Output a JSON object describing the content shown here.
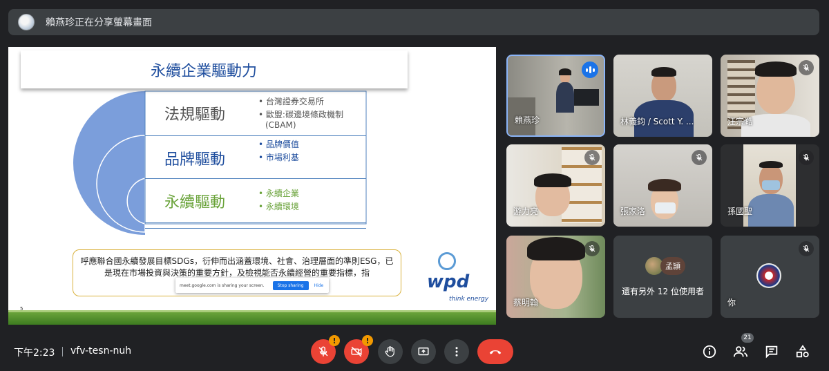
{
  "presenter_bar": {
    "text": "賴燕珍正在分享螢幕畫面"
  },
  "slide": {
    "title": "永續企業驅動力",
    "page_number": "5",
    "drivers": [
      {
        "title": "法規驅動",
        "bullets": [
          "台灣證券交易所",
          "歐盟:碳邊境條政機制",
          "(CBAM)"
        ],
        "color": "#555555"
      },
      {
        "title": "品牌驅動",
        "bullets": [
          "品牌價值",
          "市場利基"
        ],
        "color": "#1f4e9e"
      },
      {
        "title": "永續驅動",
        "bullets": [
          "永續企業",
          "永續環境"
        ],
        "color": "#6aa33a"
      }
    ],
    "ribbon_text": "呼應聯合國永續發展目標SDGs，衍伸而出涵蓋環境、社會、治理層面的準則ESG，已是現在市場投資與決策的重要方針，及檢視能否永續經營的重要指標，指",
    "share_notice": {
      "text": "meet.google.com is sharing your screen.",
      "stop": "Stop sharing",
      "hide": "Hide"
    },
    "logo": {
      "name": "wpd",
      "tagline": "think energy"
    }
  },
  "participants": [
    {
      "name": "賴燕珍",
      "status": "speaking"
    },
    {
      "name": "林義鈞 / Scott Y. ...",
      "status": "unmuted"
    },
    {
      "name": "汪宗澔",
      "status": "muted"
    },
    {
      "name": "游力亮",
      "status": "muted"
    },
    {
      "name": "張家洛",
      "status": "muted"
    },
    {
      "name": "孫國聖",
      "status": "muted"
    },
    {
      "name": "蔡明翰",
      "status": "muted"
    },
    {
      "name": "你",
      "status": "muted"
    }
  ],
  "others_tile": {
    "avatar_name": "孟頴",
    "text": "還有另外 12 位使用者"
  },
  "toolbar": {
    "time": "下午2:23",
    "meeting_code": "vfv-tesn-nuh",
    "participant_count": "21",
    "warning_mark": "!"
  },
  "colors": {
    "accent": "#8ab4f8",
    "danger": "#ea4335",
    "warning": "#f29900",
    "slide_blue": "#1f4e9e",
    "slide_green": "#6aa33a"
  }
}
